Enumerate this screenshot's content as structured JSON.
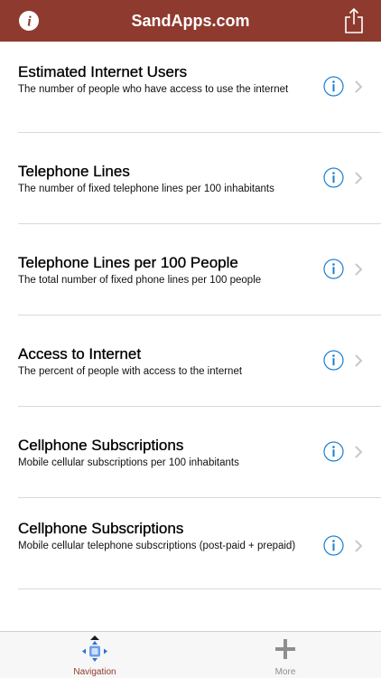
{
  "header": {
    "title": "SandApps.com",
    "info_icon": "info-icon",
    "share_icon": "share-icon",
    "bar_color": "#8f3a2e"
  },
  "list": {
    "items": [
      {
        "title": "Estimated Internet Users",
        "subtitle": "The number of people who have access to use the internet"
      },
      {
        "title": "Telephone Lines",
        "subtitle": "The number of fixed telephone lines per 100 inhabitants"
      },
      {
        "title": "Telephone Lines per 100 People",
        "subtitle": "The total number of fixed phone lines per 100 people"
      },
      {
        "title": "Access to Internet",
        "subtitle": "The percent of people with access to the internet"
      },
      {
        "title": "Cellphone Subscriptions",
        "subtitle": "Mobile cellular subscriptions per 100 inhabitants"
      },
      {
        "title": "Cellphone Subscriptions",
        "subtitle": "Mobile cellular telephone subscriptions (post-paid + prepaid)"
      }
    ],
    "accent_color": "#1a7fd4"
  },
  "tabbar": {
    "tabs": [
      {
        "label": "Navigation",
        "icon": "navigation-icon",
        "selected": true
      },
      {
        "label": "More",
        "icon": "plus-icon",
        "selected": false
      }
    ]
  }
}
